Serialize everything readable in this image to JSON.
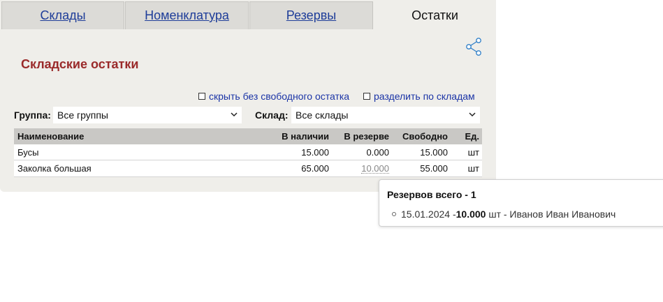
{
  "tabs": [
    {
      "label": "Склады",
      "active": false
    },
    {
      "label": "Номенклатура",
      "active": false
    },
    {
      "label": "Резервы",
      "active": false
    },
    {
      "label": "Остатки",
      "active": true
    }
  ],
  "title": "Складские остатки",
  "options": {
    "hide_no_free": "скрыть без свободного остатка",
    "split_by_warehouse": "разделить по складам"
  },
  "filters": {
    "group_label": "Группа:",
    "group_value": "Все группы",
    "warehouse_label": "Склад:",
    "warehouse_value": "Все склады"
  },
  "table": {
    "headers": {
      "name": "Наименование",
      "stock": "В наличии",
      "reserve": "В резерве",
      "free": "Свободно",
      "unit": "Ед."
    },
    "rows": [
      {
        "name": "Бусы",
        "stock": "15.000",
        "reserve": "0.000",
        "free": "15.000",
        "unit": "шт"
      },
      {
        "name": "Заколка большая",
        "stock": "65.000",
        "reserve": "10.000",
        "free": "55.000",
        "unit": "шт"
      }
    ]
  },
  "popup": {
    "title": "Резервов всего - 1",
    "item": {
      "date": "15.01.2024 - ",
      "qty": "10.000",
      "rest": " шт - Иванов Иван Иванович"
    }
  },
  "colors": {
    "accent_title": "#9a2a2a",
    "link": "#1e3d99",
    "panel_bg": "#efeeea"
  },
  "icons": {
    "share": "share-icon",
    "dropdown": "chevron-down-icon"
  }
}
